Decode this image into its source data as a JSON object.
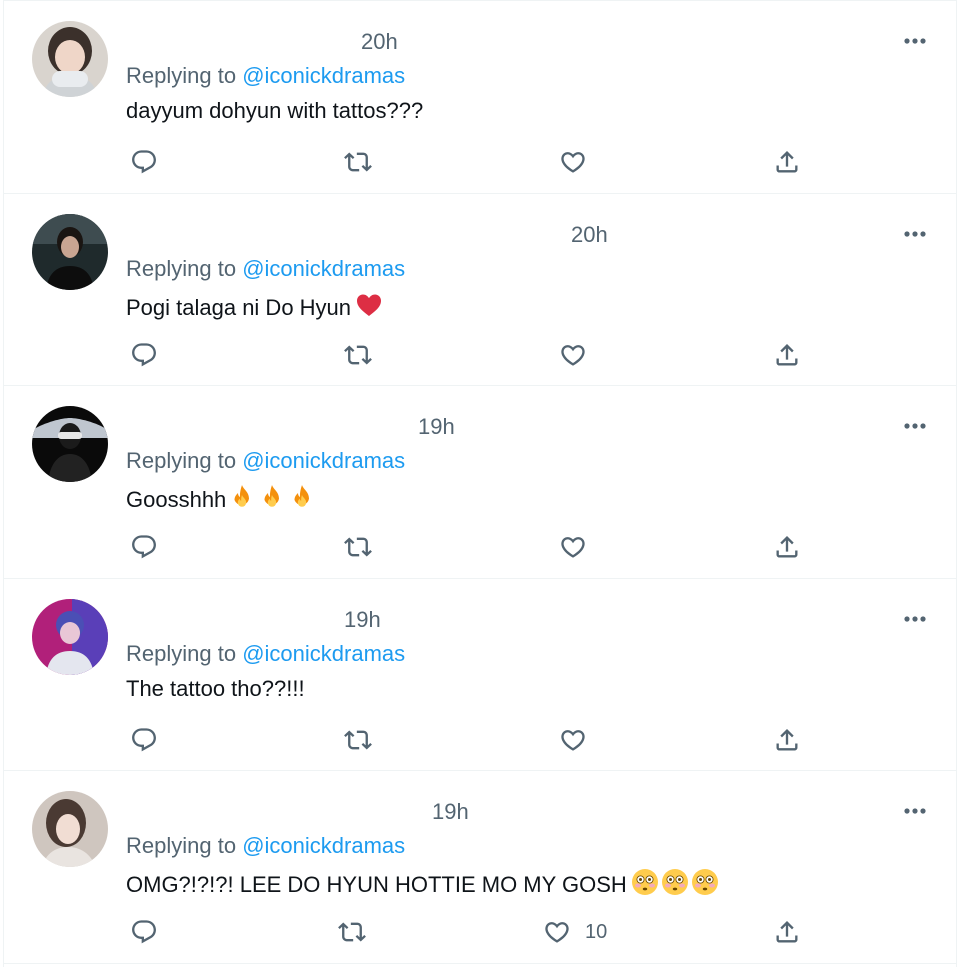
{
  "colors": {
    "secondary_text": "#536471",
    "accent": "#1d9bf0",
    "primary_text": "#0f1419",
    "divider": "#eff3f4"
  },
  "replies": [
    {
      "time": "20h",
      "replying_prefix": "Replying to",
      "handle": "@iconickdramas",
      "text": "dayyum dohyun with tattos???",
      "emoji": [],
      "like_count": ""
    },
    {
      "time": "20h",
      "replying_prefix": "Replying to",
      "handle": "@iconickdramas",
      "text": "Pogi talaga ni Do Hyun",
      "emoji": [
        "red-heart-emoji"
      ],
      "like_count": ""
    },
    {
      "time": "19h",
      "replying_prefix": "Replying to",
      "handle": "@iconickdramas",
      "text": "Goosshhh",
      "emoji": [
        "fire-emoji",
        "fire-emoji",
        "fire-emoji"
      ],
      "like_count": ""
    },
    {
      "time": "19h",
      "replying_prefix": "Replying to",
      "handle": "@iconickdramas",
      "text": "The tattoo tho??!!!",
      "emoji": [],
      "like_count": ""
    },
    {
      "time": "19h",
      "replying_prefix": "Replying to",
      "handle": "@iconickdramas",
      "text": "OMG?!?!?! LEE DO HYUN HOTTIE MO MY GOSH",
      "emoji": [
        "flushed-face-emoji",
        "flushed-face-emoji",
        "flushed-face-emoji"
      ],
      "like_count": "10"
    }
  ],
  "icons": {
    "more": "more-dots-icon",
    "reply": "reply-bubble-icon",
    "retweet": "retweet-icon",
    "like": "heart-outline-icon",
    "share": "share-upload-icon"
  }
}
